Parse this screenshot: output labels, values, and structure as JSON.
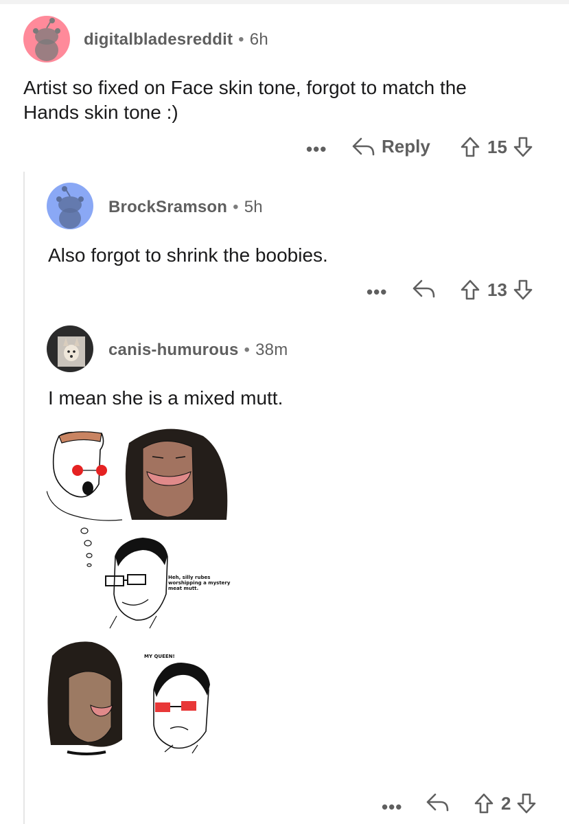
{
  "comments": [
    {
      "username": "digitalbladesreddit",
      "separator": "•",
      "age": "6h",
      "body_line1": "Artist so fixed on Face skin tone, forgot to match the",
      "body_line2": "Hands skin tone :)",
      "more_label": "•••",
      "reply_label": "Reply",
      "votes": "15",
      "avatar_color": "#ff8a9a"
    },
    {
      "username": "BrockSramson",
      "separator": "•",
      "age": "5h",
      "body": "Also forgot to shrink the boobies.",
      "more_label": "•••",
      "votes": "13",
      "avatar_color": "#8aa8f5"
    },
    {
      "username": "canis-humurous",
      "separator": "•",
      "age": "38m",
      "body": "I mean she is a mixed mutt.",
      "more_label": "•••",
      "votes": "2",
      "avatar_color": "#2b2b2b"
    }
  ],
  "meme": {
    "caption_1": "Heh, silly rubes worshipping a mystery meat mutt.",
    "caption_2": "MY QUEEN!"
  },
  "icons": {
    "reply": "reply-arrow-icon",
    "upvote": "upvote-arrow-icon",
    "downvote": "downvote-arrow-icon",
    "avatar": "snoo-avatar-icon"
  }
}
